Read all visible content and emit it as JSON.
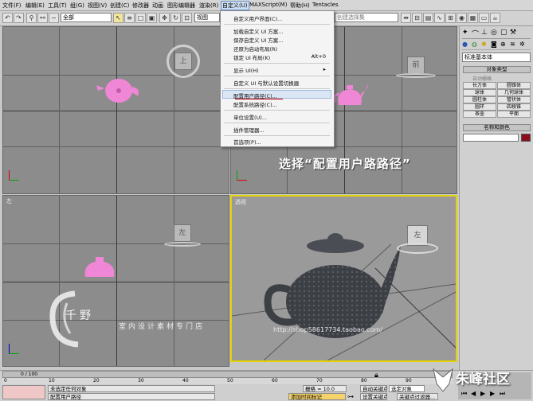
{
  "menubar": {
    "items": [
      "文件(F)",
      "编辑(E)",
      "工具(T)",
      "组(G)",
      "视图(V)",
      "创建(C)",
      "修改器",
      "动画",
      "图形编辑器",
      "渲染(R)",
      "自定义(U)",
      "MAXScript(M)",
      "帮助(H)",
      "Tentacles"
    ]
  },
  "toolbar": {
    "selection_filter": "全部",
    "view_select": "视图",
    "named_sets": "创建选择集"
  },
  "dropdown": {
    "items": [
      {
        "label": "自定义用户界面(C)...",
        "shortcut": ""
      },
      {
        "label": "加载自定义 UI 方案...",
        "shortcut": ""
      },
      {
        "label": "保存自定义 UI 方案...",
        "shortcut": ""
      },
      {
        "label": "还原为启动布局(R)",
        "shortcut": ""
      },
      {
        "label": "锁定 UI 布局(K)",
        "shortcut": "Alt+0"
      },
      {
        "label": "显示 UI(H)",
        "shortcut": "▸"
      },
      {
        "label": "自定义 UI 与默认设置切换器",
        "shortcut": ""
      },
      {
        "label": "配置用户路径(C)...",
        "shortcut": ""
      },
      {
        "label": "配置系统路径(C)...",
        "shortcut": ""
      },
      {
        "label": "单位设置(U)...",
        "shortcut": ""
      },
      {
        "label": "插件管理器...",
        "shortcut": ""
      },
      {
        "label": "首选项(P)...",
        "shortcut": ""
      }
    ]
  },
  "annotation": {
    "instruction": "选择“配置用户路路径”"
  },
  "viewports": {
    "top_label": "顶",
    "front_label": "前",
    "left_label": "左",
    "persp_label": "透视",
    "cube_top": "上",
    "cube_front": "前",
    "cube_left": "左",
    "cube_persp": "左"
  },
  "watermark": {
    "shop_name": "室内设计素材专门店",
    "shop_url": "http://shop58617734.taobao.com/",
    "logo_text": "千野",
    "site_logo": "朱峰社区"
  },
  "command_panel": {
    "dropdown": "标准基本体",
    "rollout_object_type": "对象类型",
    "autogrid": "自动栅格",
    "buttons": [
      "长方体",
      "圆锥体",
      "球体",
      "几何球体",
      "圆柱体",
      "管状体",
      "圆环",
      "四棱锥",
      "茶壶",
      "平面"
    ],
    "rollout_name_color": "名称和颜色"
  },
  "timeline": {
    "frame_counter": "0 / 100",
    "ticks": [
      "0",
      "5",
      "10",
      "15",
      "20",
      "25",
      "30",
      "35",
      "40",
      "45",
      "50",
      "55",
      "60",
      "65",
      "70",
      "75",
      "80",
      "85",
      "90",
      "95",
      "100"
    ]
  },
  "statusbar": {
    "selection_status": "未选定任何对象",
    "prompt": "配置用户路径",
    "grid": "栅格 = 10.0",
    "auto_key": "自动关键点",
    "selected": "选定对象",
    "set_key": "设置关键点",
    "key_filters": "关键点过滤器...",
    "add_time_tag": "添加时间标记"
  },
  "colors": {
    "viewport_bg": "#8c8c8c",
    "active_border": "#e6d200",
    "teapot_pink": "#ef86d6",
    "highlight_underline": "#c00000"
  }
}
